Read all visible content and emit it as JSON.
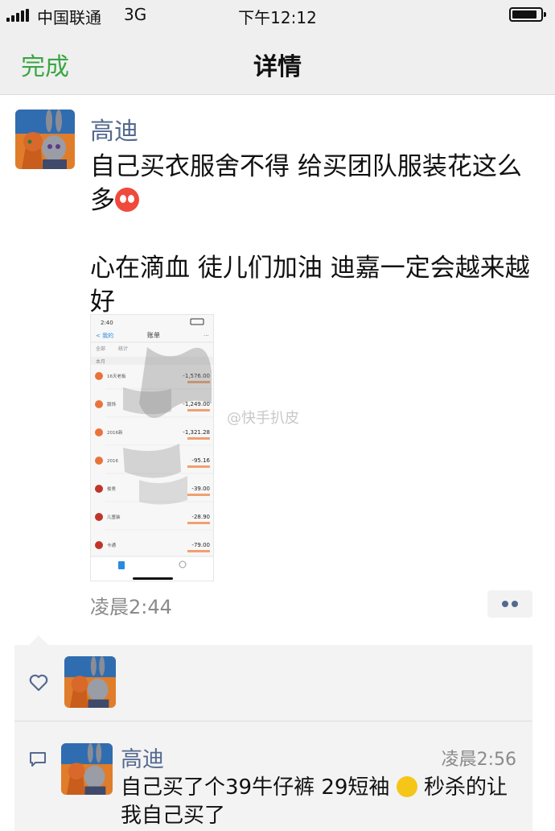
{
  "status_bar": {
    "carrier": "中国联通",
    "network": "3G",
    "time": "下午12:12"
  },
  "nav": {
    "done_label": "完成",
    "title": "详情"
  },
  "post": {
    "author": "高迪",
    "text_line1": "自己买衣服舍不得 给买团队服装花这么多",
    "text_line2": "心在滴血 徒儿们加油  迪嘉一定会越来越好",
    "time": "凌晨2:44",
    "image": {
      "status_time": "2:40",
      "back_label": "< 我的",
      "title": "账单",
      "filter_left": "全部",
      "filter_right": "统计",
      "section": "本月",
      "amounts": [
        "-1,576.00",
        "-1,249.00",
        "-1,321.28",
        "-95.16",
        "-39.00",
        "-28.90",
        "-79.00"
      ],
      "row_labels": [
        "16天老板",
        "服饰",
        "2016新",
        "2016",
        "俊男",
        "儿童装",
        "卡通"
      ]
    }
  },
  "watermark": "@快手扒皮",
  "likes": {},
  "comment": {
    "author": "高迪",
    "time": "凌晨2:56",
    "text_a": "自己买了个39牛仔裤 29短袖 ",
    "text_b": " 秒杀的让我自己买了"
  },
  "colors": {
    "accent_green": "#3aa644",
    "name_blue": "#55698f"
  }
}
